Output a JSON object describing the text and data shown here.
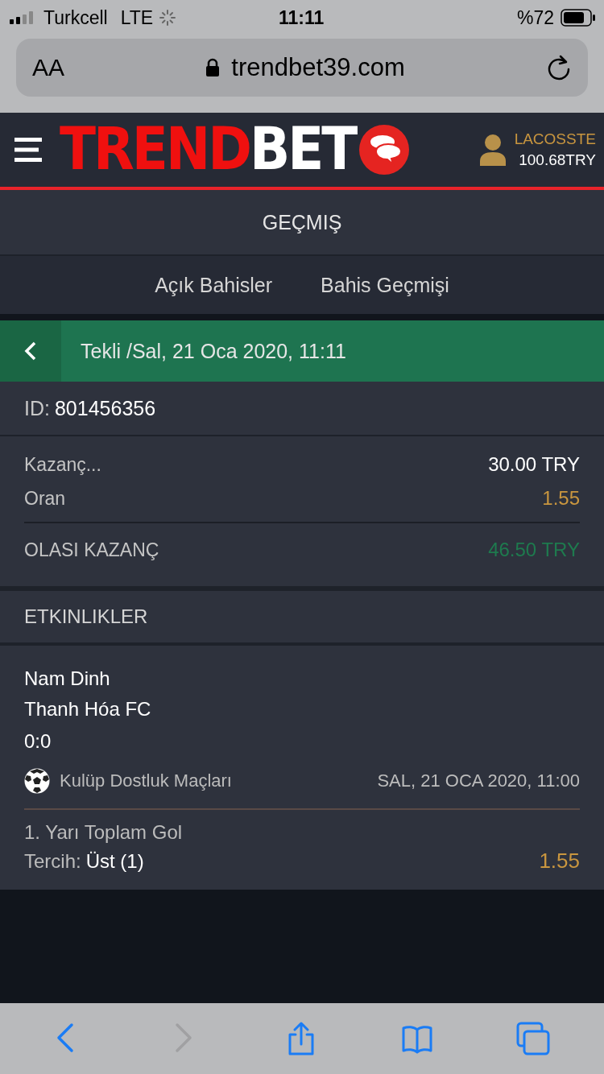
{
  "status_bar": {
    "carrier": "Turkcell",
    "network": "LTE",
    "time": "11:11",
    "battery": "%72"
  },
  "browser": {
    "text_size_button": "AA",
    "url": "trendbet39.com"
  },
  "header": {
    "logo_red": "TREND",
    "logo_white": "BET",
    "username": "LACOSSTE",
    "balance": "100.68TRY"
  },
  "page_title": "GEÇMIŞ",
  "tabs": [
    {
      "label": "Açık Bahisler"
    },
    {
      "label": "Bahis Geçmişi"
    }
  ],
  "bet": {
    "title": "Tekli /Sal, 21 Oca 2020, 11:11",
    "id_label": "ID:",
    "id": "801456356",
    "summary": [
      {
        "label": "Kazanç...",
        "value": "30.00 TRY",
        "kind": "stake"
      },
      {
        "label": "Oran",
        "value": "1.55",
        "kind": "odds"
      },
      {
        "label": "OLASI KAZANÇ",
        "value": "46.50 TRY",
        "kind": "payout"
      }
    ]
  },
  "events_title": "ETKINLIKLER",
  "events": [
    {
      "home": "Nam Dinh",
      "away": "Thanh Hóa FC",
      "score": "0:0",
      "league": "Kulüp Dostluk Maçları",
      "date": "SAL, 21 OCA 2020, 11:00",
      "market": "1. Yarı Toplam Gol",
      "pick_label": "Tercih:",
      "pick": "Üst (1)",
      "odds": "1.55"
    }
  ]
}
